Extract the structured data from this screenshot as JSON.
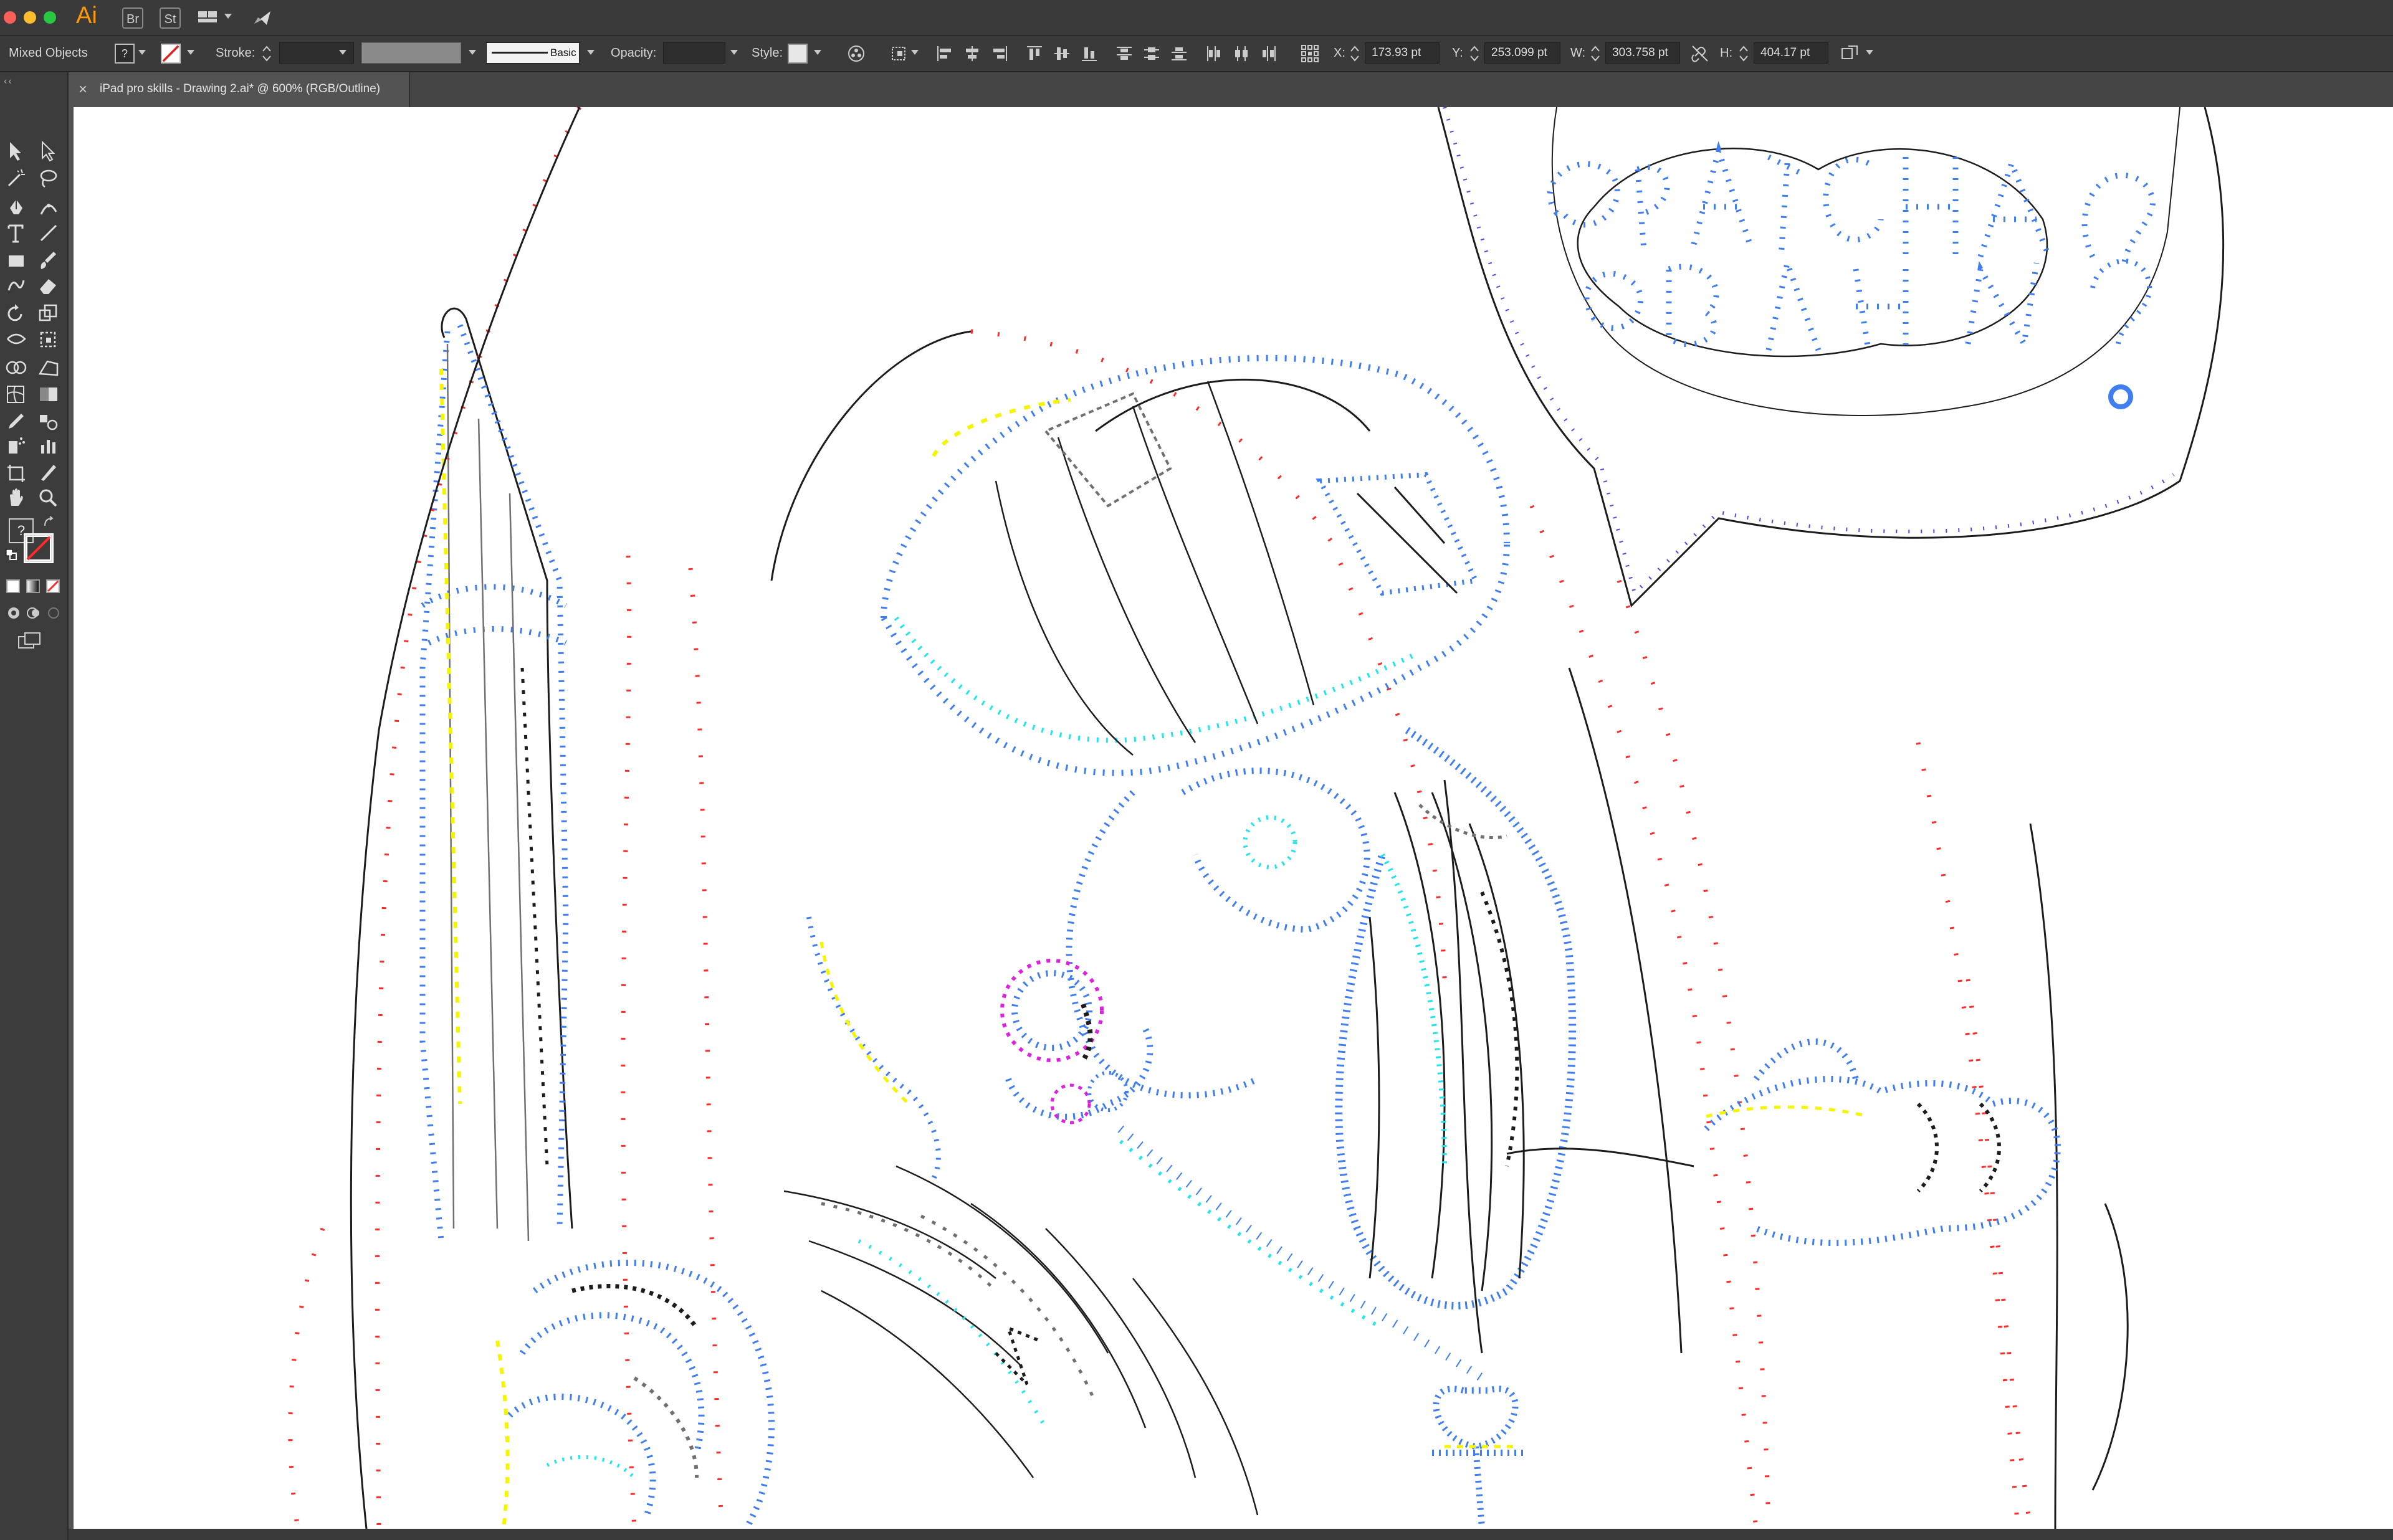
{
  "app": {
    "logo_text": "Ai",
    "bridge_label": "Br",
    "stock_label": "St"
  },
  "colors": {
    "outline_black": "#1c1c1c",
    "outline_blue": "#3f7df0",
    "outline_cyan": "#1fe5ee",
    "outline_yellow": "#f5f500",
    "outline_red": "#ff2a2a",
    "outline_magenta": "#e020e0",
    "outline_grey": "#707070",
    "outline_violet": "#5148e6",
    "accent_orange": "#ff9a00"
  },
  "control_bar": {
    "selection_label": "Mixed Objects",
    "stroke_label": "Stroke:",
    "stroke_value": "",
    "brush_label": "Basic",
    "opacity_label": "Opacity:",
    "opacity_value": "",
    "style_label": "Style:",
    "x_label": "X:",
    "x_value": "173.93 pt",
    "y_label": "Y:",
    "y_value": "253.099 pt",
    "w_label": "W:",
    "w_value": "303.758 pt",
    "h_label": "H:",
    "h_value": "404.17 pt"
  },
  "document_tab": {
    "close_symbol": "×",
    "title": "iPad pro skills - Drawing 2.ai* @ 600% (RGB/Outline)"
  },
  "tools": {
    "unknown_fill": "?"
  },
  "status_bar": {
    "text": ""
  },
  "icons": [
    "selection-tool-icon",
    "direct-selection-tool-icon",
    "magic-wand-icon",
    "lasso-icon",
    "pen-tool-icon",
    "curvature-icon",
    "type-tool-icon",
    "line-tool-icon",
    "rectangle-tool-icon",
    "paintbrush-icon",
    "shaper-icon",
    "eraser-icon",
    "rotate-icon",
    "scale-icon",
    "width-icon",
    "free-transform-icon",
    "shape-builder-icon",
    "perspective-icon",
    "mesh-icon",
    "gradient-icon",
    "eyedropper-icon",
    "blend-icon",
    "symbol-sprayer-icon",
    "graph-icon",
    "artboard-icon",
    "slice-icon",
    "hand-icon",
    "zoom-icon"
  ]
}
